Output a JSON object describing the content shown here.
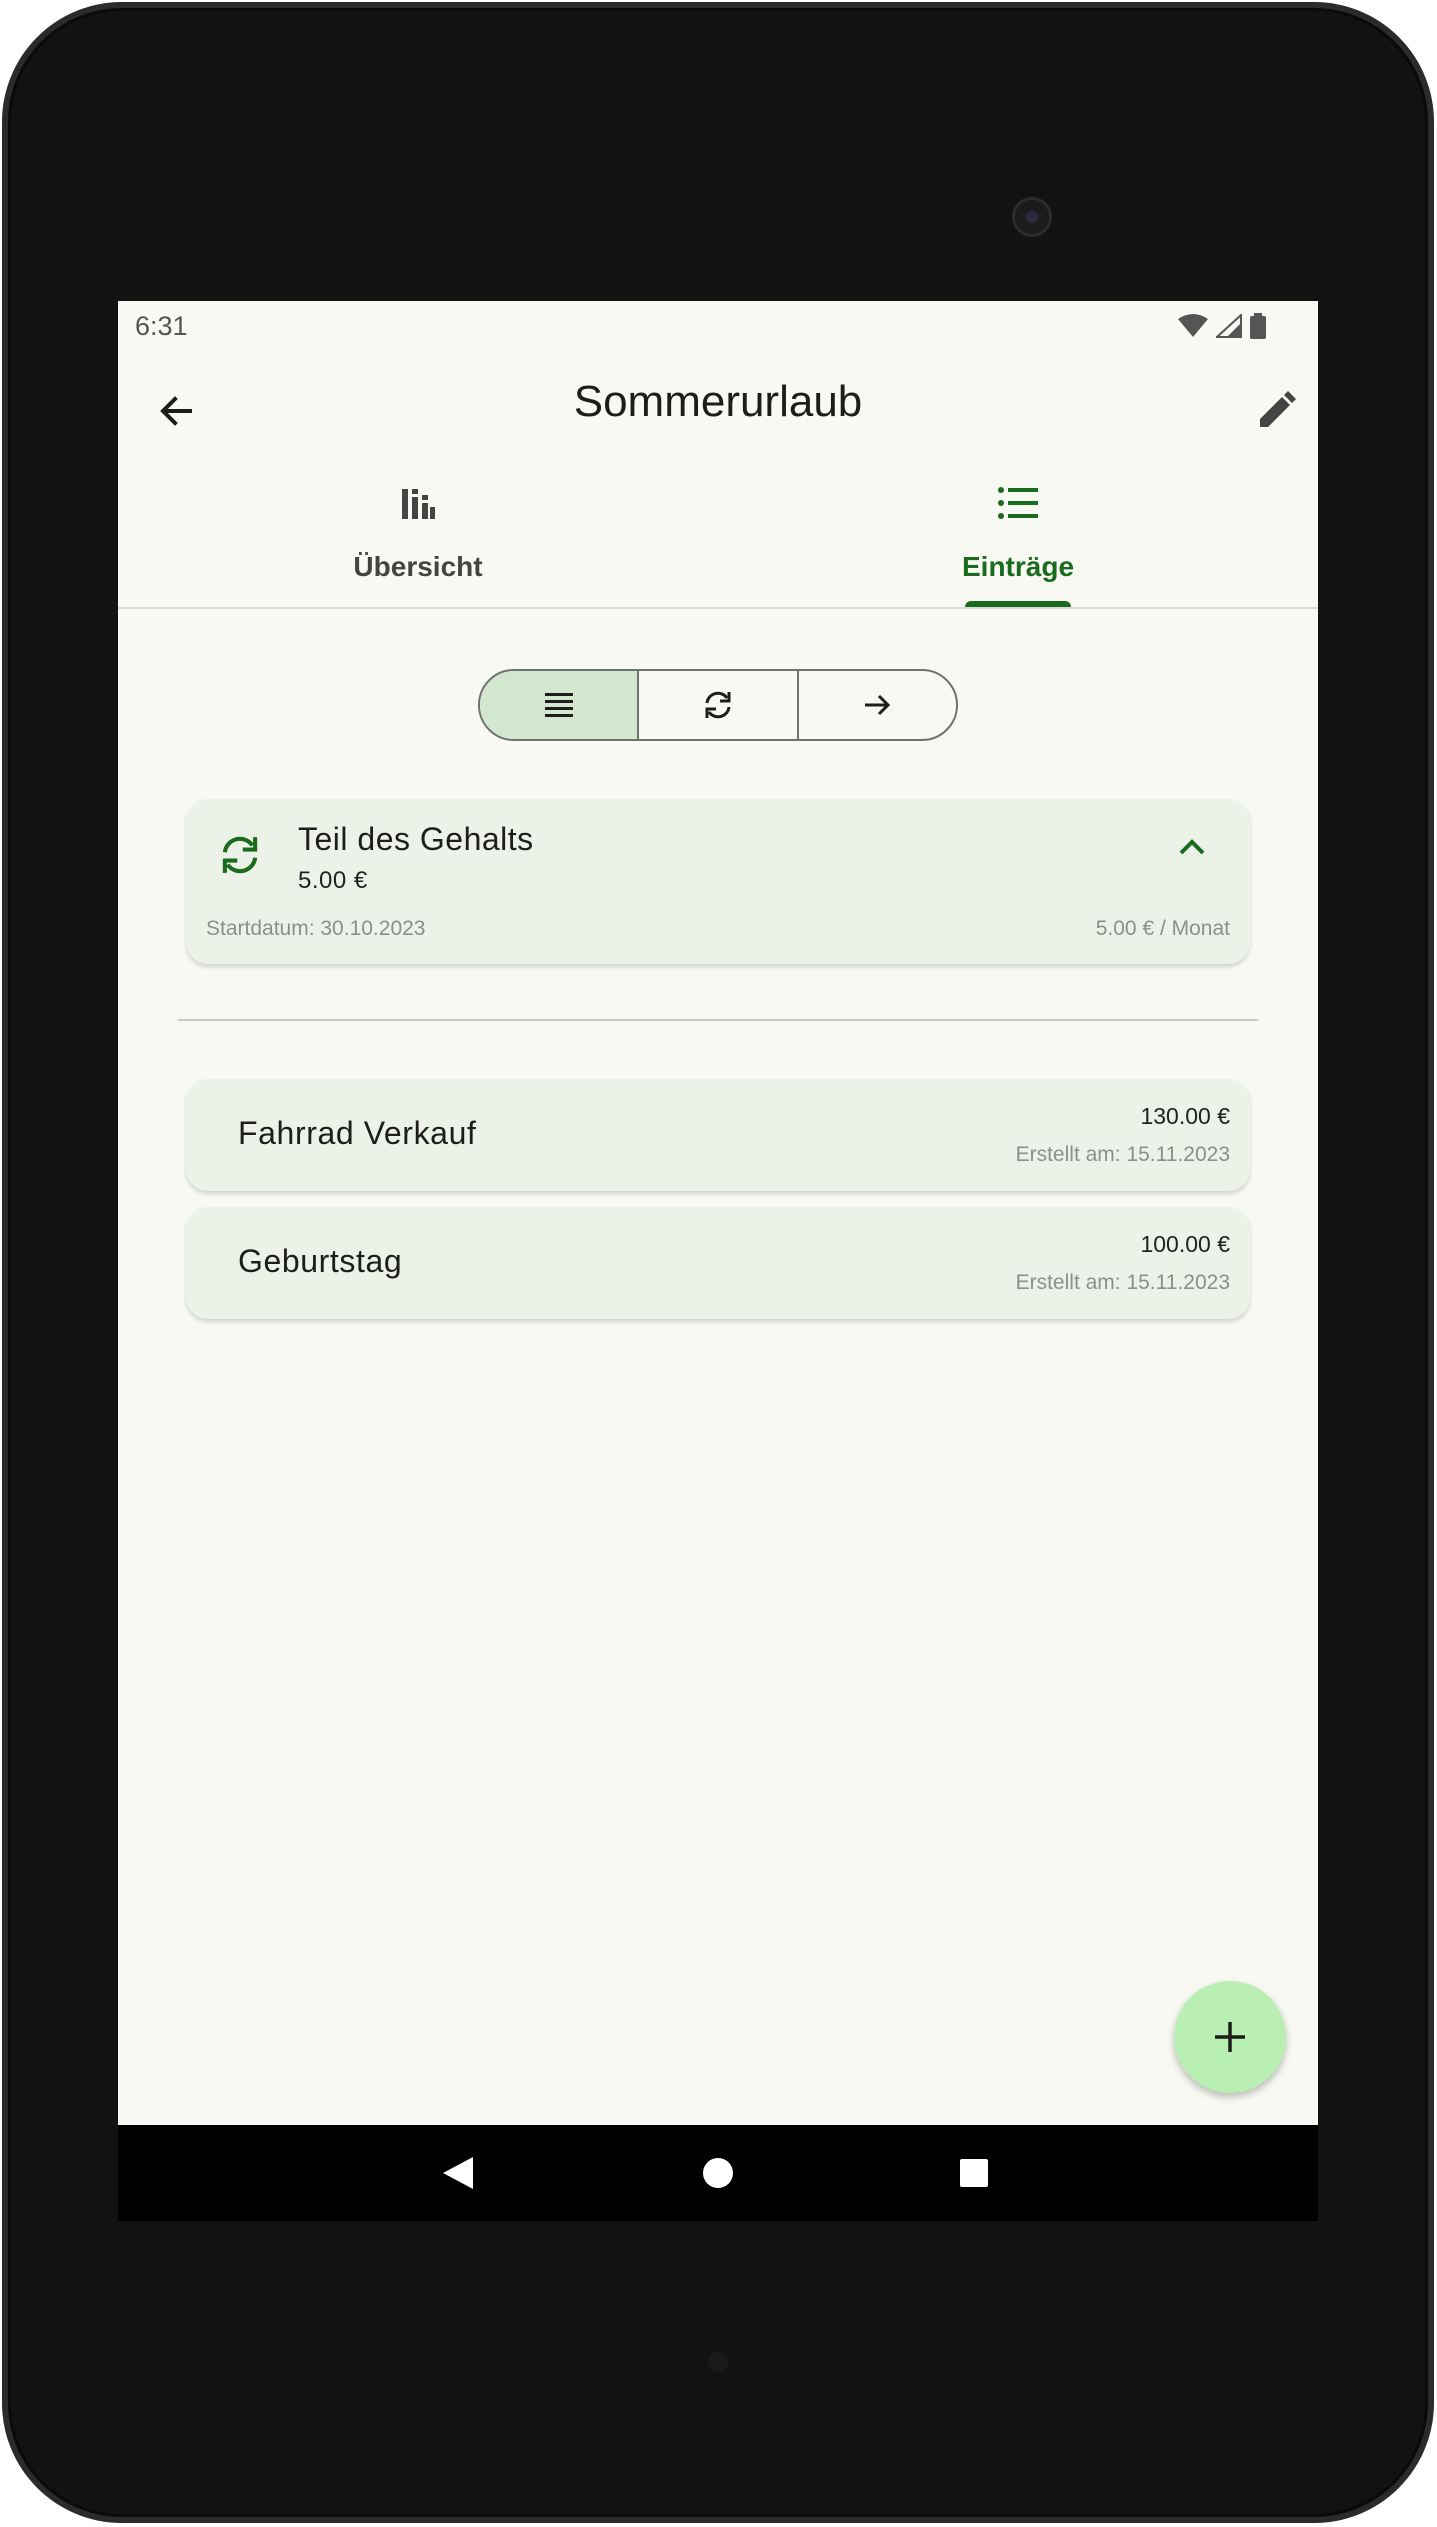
{
  "status_bar": {
    "time": "6:31"
  },
  "app_bar": {
    "title": "Sommerurlaub"
  },
  "tabs": [
    {
      "label": "Übersicht",
      "icon": "bar-chart-icon",
      "active": false
    },
    {
      "label": "Einträge",
      "icon": "list-icon",
      "active": true
    }
  ],
  "segmented": [
    {
      "icon": "list-lines-icon",
      "selected": true
    },
    {
      "icon": "sync-icon",
      "selected": false
    },
    {
      "icon": "arrow-right-icon",
      "selected": false
    }
  ],
  "recurring": {
    "title": "Teil des Gehalts",
    "amount": "5.00 €",
    "start_date": "Startdatum: 30.10.2023",
    "rate": "5.00 € / Monat"
  },
  "entries": [
    {
      "name": "Fahrrad Verkauf",
      "amount": "130.00 €",
      "created": "Erstellt am: 15.11.2023"
    },
    {
      "name": "Geburtstag",
      "amount": "100.00 €",
      "created": "Erstellt am: 15.11.2023"
    }
  ],
  "colors": {
    "accent": "#1a6b1e",
    "background": "#f9f9f3",
    "card": "#edf2e9",
    "fab": "#b9efb2",
    "segment_selected": "#d3e6cf"
  }
}
